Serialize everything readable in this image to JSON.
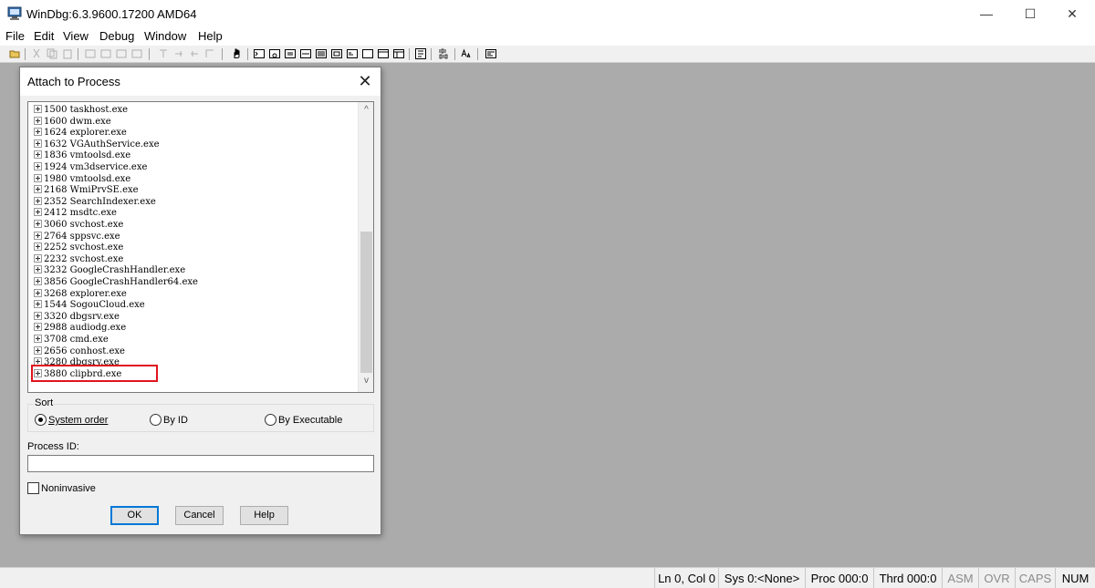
{
  "window": {
    "title": "WinDbg:6.3.9600.17200 AMD64",
    "minimize_glyph": "—",
    "maximize_glyph": "☐",
    "close_glyph": "✕"
  },
  "menu": [
    "File",
    "Edit",
    "View",
    "Debug",
    "Window",
    "Help"
  ],
  "statusbar": {
    "ln_col": "Ln 0, Col 0",
    "sys": "Sys 0:<None>",
    "proc": "Proc 000:0",
    "thrd": "Thrd 000:0",
    "asm": "ASM",
    "ovr": "OVR",
    "caps": "CAPS",
    "num": "NUM"
  },
  "dialog": {
    "title": "Attach to Process",
    "close_glyph": "✕",
    "processes": [
      "1500 taskhost.exe",
      "1600 dwm.exe",
      "1624 explorer.exe",
      "1632 VGAuthService.exe",
      "1836 vmtoolsd.exe",
      "1924 vm3dservice.exe",
      "1980 vmtoolsd.exe",
      "2168 WmiPrvSE.exe",
      "2352 SearchIndexer.exe",
      "2412 msdtc.exe",
      "3060 svchost.exe",
      "2764 sppsvc.exe",
      "2252 svchost.exe",
      "2232 svchost.exe",
      "3232 GoogleCrashHandler.exe",
      "3856 GoogleCrashHandler64.exe",
      "3268 explorer.exe",
      "1544 SogouCloud.exe",
      "3320 dbgsrv.exe",
      "2988 audiodg.exe",
      "3708 cmd.exe",
      "2656 conhost.exe",
      "3280 dbgsrv.exe",
      "3880 clipbrd.exe"
    ],
    "highlighted_process": "3880 clipbrd.exe",
    "highlight_color": "#e0141e",
    "scroll_up_glyph": "^",
    "scroll_down_glyph": "v",
    "sort": {
      "label": "Sort",
      "options": [
        "System order",
        "By ID",
        "By Executable"
      ],
      "selected": "System order"
    },
    "process_id_label": "Process ID:",
    "process_id_value": "",
    "noninvasive_label": "Noninvasive",
    "noninvasive_checked": false,
    "buttons": {
      "ok": "OK",
      "cancel": "Cancel",
      "help": "Help"
    }
  }
}
